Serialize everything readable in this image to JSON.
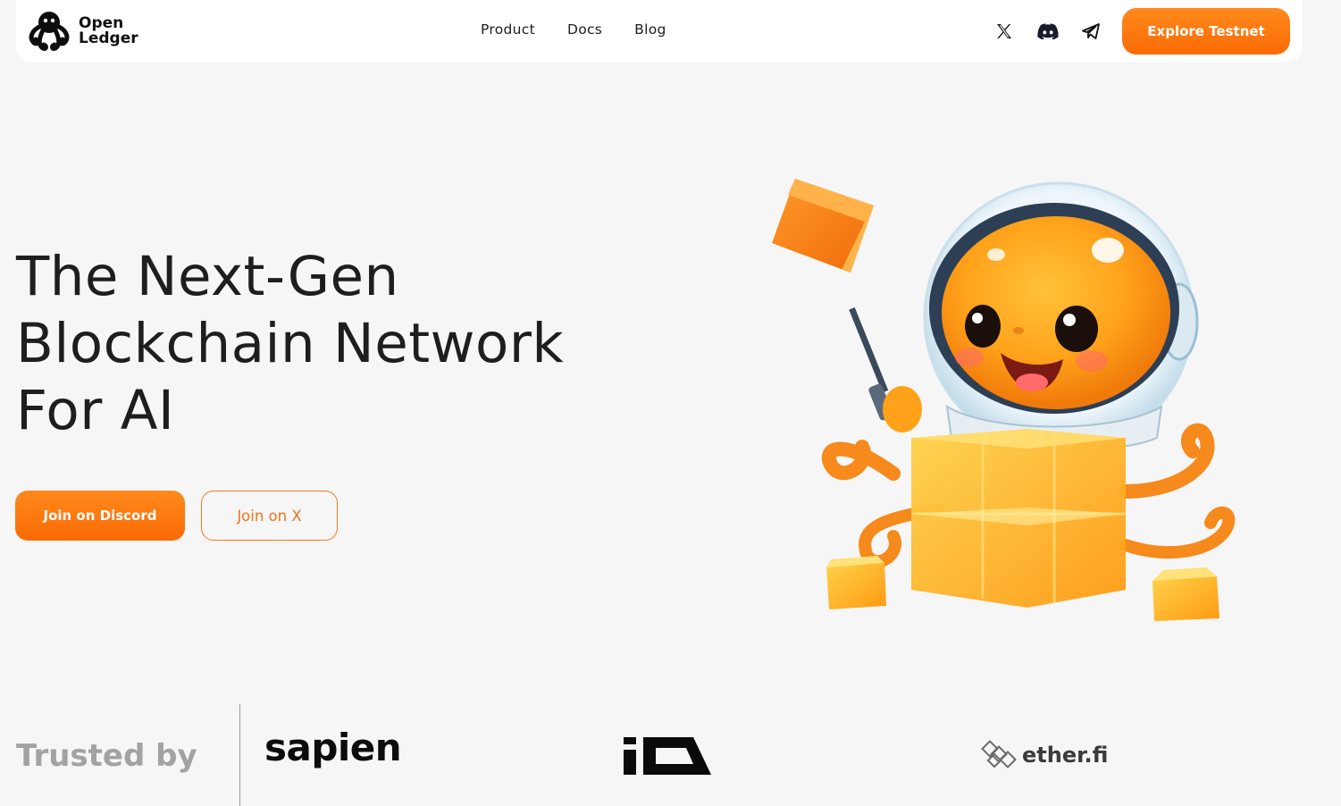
{
  "brand": {
    "name_line1": "Open",
    "name_line2": "Ledger",
    "accent": "#fb6a05"
  },
  "nav": {
    "links": [
      {
        "label": "Product"
      },
      {
        "label": "Docs"
      },
      {
        "label": "Blog"
      }
    ],
    "social_icons": [
      "x-icon",
      "discord-icon",
      "telegram-icon"
    ],
    "cta_label": "Explore Testnet"
  },
  "hero": {
    "title_lines": [
      "The Next-Gen",
      "Blockchain Network",
      "For AI"
    ],
    "primary_cta": "Join on Discord",
    "secondary_cta": "Join on X",
    "illustration": "octopus-astronaut-with-cubes"
  },
  "trusted": {
    "label": "Trusted by",
    "partners": [
      {
        "name": "sapien"
      },
      {
        "name": "io",
        "logo": "io-logo"
      },
      {
        "name": "ether.fi"
      }
    ]
  }
}
